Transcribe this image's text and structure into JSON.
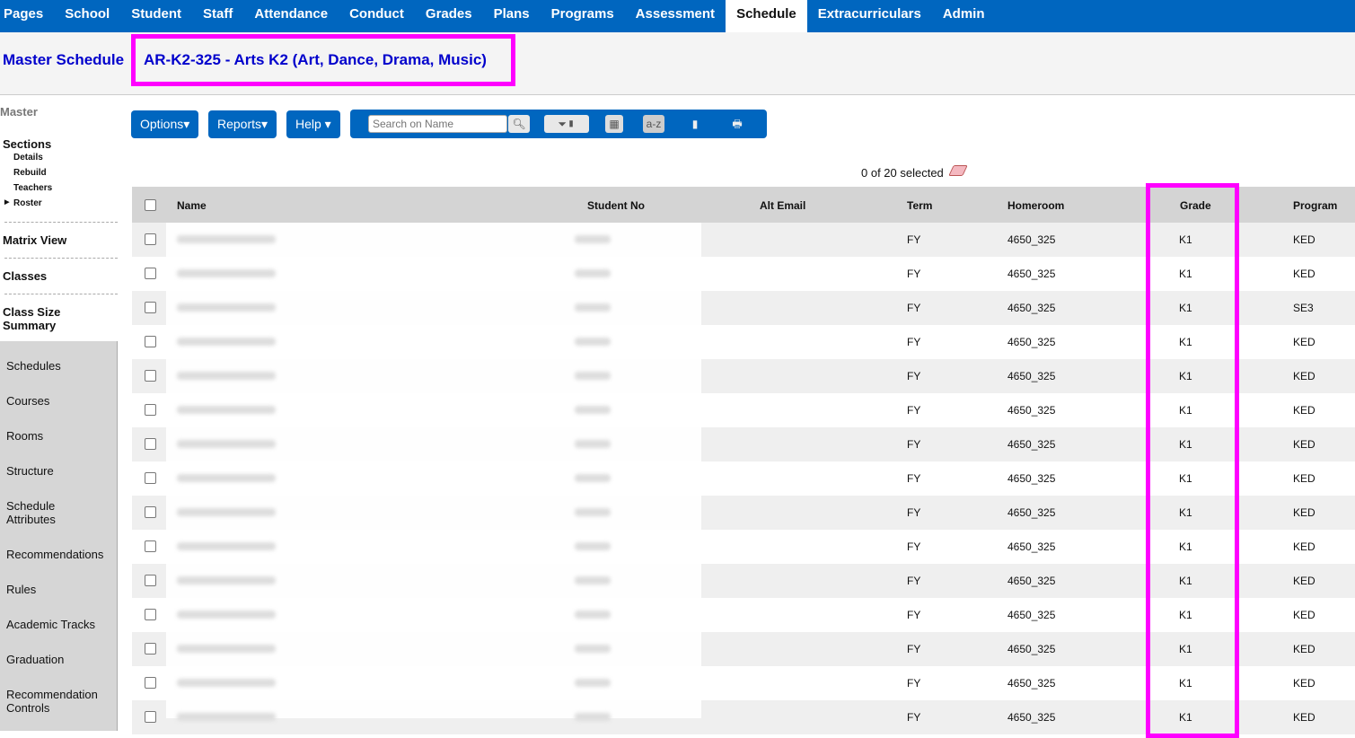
{
  "nav": [
    "Pages",
    "School",
    "Student",
    "Staff",
    "Attendance",
    "Conduct",
    "Grades",
    "Plans",
    "Programs",
    "Assessment",
    "Schedule",
    "Extracurriculars",
    "Admin"
  ],
  "nav_active": "Schedule",
  "header": {
    "module": "Master Schedule",
    "course": "AR-K2-325 - Arts K2 (Art, Dance, Drama, Music)"
  },
  "sidebar": {
    "top": "Master",
    "sections": "Sections",
    "sub": [
      "Details",
      "Rebuild",
      "Teachers",
      "Roster"
    ],
    "links": [
      "Matrix View",
      "Classes",
      "Class Size Summary"
    ],
    "gray": [
      "Schedules",
      "Courses",
      "Rooms",
      "Structure",
      "Schedule Attributes",
      "Recommendations",
      "Rules",
      "Academic Tracks",
      "Graduation",
      "Recommendation Controls"
    ]
  },
  "toolbar": {
    "options": "Options▾",
    "reports": "Reports▾",
    "help": "Help ▾",
    "search_placeholder": "Search on Name",
    "sort": "a-z"
  },
  "selection": "0 of 20 selected",
  "table": {
    "headers": [
      "Name",
      "Student No",
      "Alt Email",
      "Term",
      "Homeroom",
      "Grade",
      "Program"
    ],
    "rows": [
      [
        "FY",
        "4650_325",
        "K1",
        "KED"
      ],
      [
        "FY",
        "4650_325",
        "K1",
        "KED"
      ],
      [
        "FY",
        "4650_325",
        "K1",
        "SE3"
      ],
      [
        "FY",
        "4650_325",
        "K1",
        "KED"
      ],
      [
        "FY",
        "4650_325",
        "K1",
        "KED"
      ],
      [
        "FY",
        "4650_325",
        "K1",
        "KED"
      ],
      [
        "FY",
        "4650_325",
        "K1",
        "KED"
      ],
      [
        "FY",
        "4650_325",
        "K1",
        "KED"
      ],
      [
        "FY",
        "4650_325",
        "K1",
        "KED"
      ],
      [
        "FY",
        "4650_325",
        "K1",
        "KED"
      ],
      [
        "FY",
        "4650_325",
        "K1",
        "KED"
      ],
      [
        "FY",
        "4650_325",
        "K1",
        "KED"
      ],
      [
        "FY",
        "4650_325",
        "K1",
        "KED"
      ],
      [
        "FY",
        "4650_325",
        "K1",
        "KED"
      ],
      [
        "FY",
        "4650_325",
        "K1",
        "KED"
      ]
    ]
  }
}
